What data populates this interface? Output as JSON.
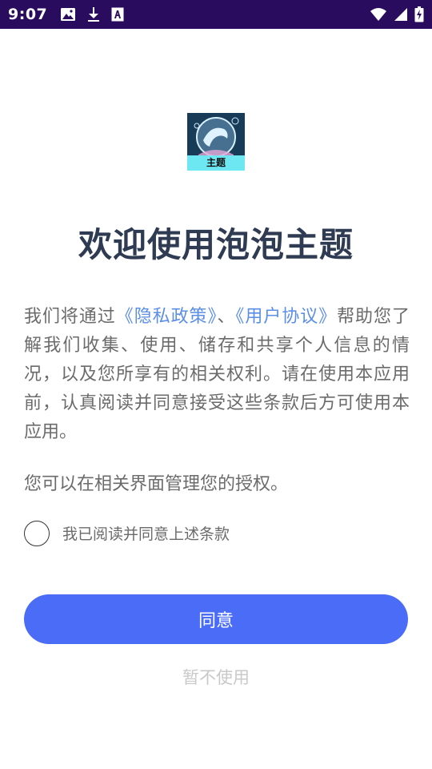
{
  "status_bar": {
    "time": "9:07",
    "left_icons": [
      "image-icon",
      "download-icon",
      "font-icon"
    ],
    "right_icons": [
      "wifi-icon",
      "signal-icon",
      "battery-charging-icon"
    ],
    "background": "#2a0c5e"
  },
  "app": {
    "icon_label": "主题",
    "icon_name": "dolphin-bubble-app-icon"
  },
  "welcome": {
    "title": "欢迎使用泡泡主题"
  },
  "intro": {
    "part1": "我们将通过",
    "privacy_link": "《隐私政策》",
    "separator": "、",
    "user_agreement_link": "《用户协议》",
    "part2": "帮助您了解我们收集、使用、储存和共享个人信息的情况，以及您所享有的相关权利。请在使用本应用前，认真阅读并同意接受这些条款后方可使用本应用。"
  },
  "authorization": {
    "text": "您可以在相关界面管理您的授权。"
  },
  "consent": {
    "label": "我已阅读并同意上述条款",
    "checked": false
  },
  "buttons": {
    "agree_label": "同意",
    "decline_label": "暂不使用"
  },
  "colors": {
    "accent": "#4a6cf7",
    "link": "#5b8ee6",
    "title": "#2f3b52",
    "body_text": "#6b6b6b",
    "muted": "#c9c9c9"
  }
}
